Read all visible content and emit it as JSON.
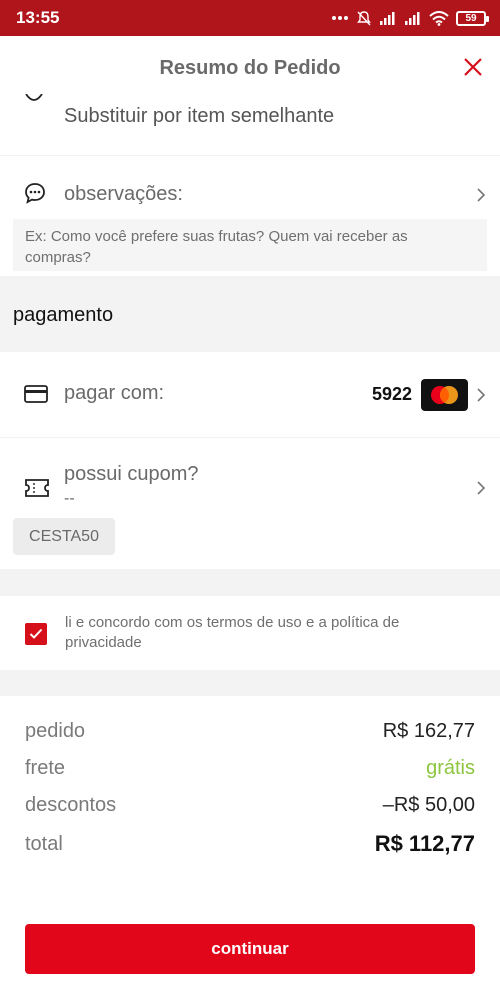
{
  "status_bar": {
    "time": "13:55",
    "battery": "59",
    "icons": [
      "more-dots-icon",
      "mute-icon",
      "signal-icon",
      "signal-icon",
      "wifi-icon",
      "battery-icon"
    ]
  },
  "header": {
    "title": "Resumo do Pedido",
    "close_icon": "close-icon"
  },
  "items": {
    "substitute_label": "Substituir por item semelhante"
  },
  "notes": {
    "label": "observações:",
    "placeholder": "Ex: Como você prefere suas frutas? Quem vai receber as compras?"
  },
  "payment": {
    "section_title": "pagamento",
    "pay_with_label": "pagar com:",
    "card_last4": "5922",
    "card_brand": "mastercard"
  },
  "coupon": {
    "label": "possui cupom?",
    "value": "--",
    "code": "CESTA50"
  },
  "terms": {
    "checked": true,
    "text": "li e concordo com os termos de uso e a política de privacidade"
  },
  "summary": {
    "rows": [
      {
        "label": "pedido",
        "value": "R$ 162,77"
      },
      {
        "label": "frete",
        "value": "grátis"
      },
      {
        "label": "descontos",
        "value": "–R$ 50,00"
      },
      {
        "label": "total",
        "value": "R$ 112,77"
      }
    ]
  },
  "actions": {
    "continue_label": "continuar"
  },
  "colors": {
    "status_bar": "#b1151c",
    "accent": "#e1061a",
    "free_shipping": "#8cc63f"
  }
}
